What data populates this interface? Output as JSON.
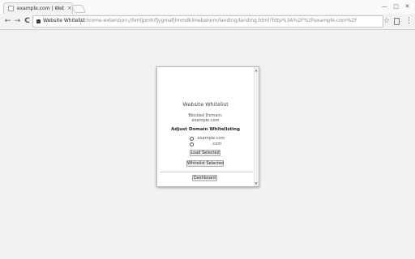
{
  "browser": {
    "tab_title": "example.com | Website W",
    "tab_close": "×",
    "omnibox_chip": "Website Whitelist",
    "url": "chrome-extension://bmljpmhifjygmafjlmmdklmebahom/landing/landing.html?http%3A%2F%2Fexample.com%2F",
    "window_minimize": "—",
    "window_maximize": "□",
    "window_close": "✕",
    "back": "←",
    "forward": "→",
    "reload": "C",
    "star": "☆",
    "menu": "⋮"
  },
  "popup": {
    "title": "Website Whitelist",
    "blocked_label": "Blocked Domain:",
    "blocked_domain": "example.com",
    "adjust_heading": "Adjust Domain Whitelisting",
    "options": [
      {
        "label": ".example.com",
        "selected": false
      },
      {
        "label": ".com",
        "selected": false
      }
    ],
    "load_selected": "Load Selected",
    "whitelist_selected": "Whitelist Selected",
    "dashboard": "Dashboard"
  },
  "icons": {
    "tab_favicon": "page-icon",
    "chip_icon": "puzzle-icon",
    "extension": "bookmark-icon"
  }
}
